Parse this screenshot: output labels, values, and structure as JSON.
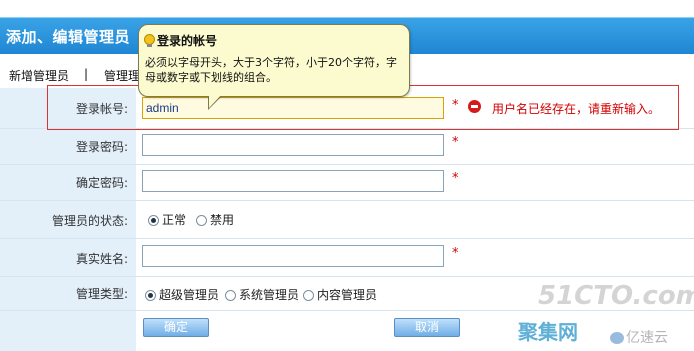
{
  "header": {
    "title": "添加、编辑管理员"
  },
  "subnav": {
    "add_label": "新增管理员",
    "separator": "|",
    "list_label": "管理理"
  },
  "tooltip": {
    "title": "登录的帐号",
    "body": "必须以字母开头，大于3个字符，小于20个字符，字母或数字或下划线的组合。"
  },
  "form": {
    "account": {
      "label": "登录帐号:",
      "value": "admin",
      "required": "*"
    },
    "error": {
      "text": "用户名已经存在，请重新输入。"
    },
    "password": {
      "label": "登录密码:",
      "value": "",
      "required": "*"
    },
    "confirm": {
      "label": "确定密码:",
      "value": "",
      "required": "*"
    },
    "status": {
      "label": "管理员的状态:",
      "options": [
        "正常",
        "禁用"
      ],
      "selected": "正常"
    },
    "realname": {
      "label": "真实姓名:",
      "value": "",
      "required": "*"
    },
    "type": {
      "label": "管理类型:",
      "options": [
        "超级管理员",
        "系统管理员",
        "内容管理员"
      ],
      "selected": "超级管理员"
    }
  },
  "buttons": {
    "ok": "确定",
    "cancel": "取消"
  },
  "watermark": {
    "site": "51CTO.com",
    "brand": "亿速云",
    "cn": "聚集网"
  },
  "colors": {
    "header": "#2592dc",
    "error": "#d20000",
    "tooltip_bg": "#fbfbcf"
  }
}
